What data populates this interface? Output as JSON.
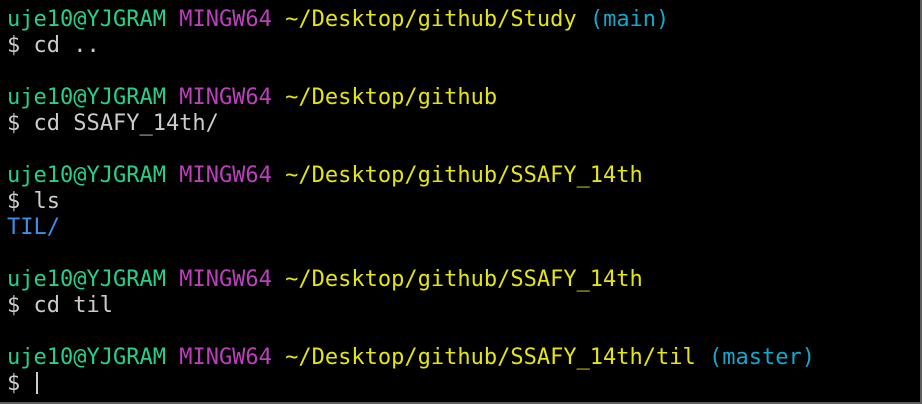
{
  "colors": {
    "background": "#000000",
    "user": "#23d18b",
    "system": "#bc3fbc",
    "path": "#e5e510",
    "branch": "#11a8cd",
    "directory": "#3b8eea",
    "text": "#cccccc"
  },
  "blocks": [
    {
      "prompt": {
        "user": "uje10@YJGRAM",
        "system": "MINGW64",
        "path": "~/Desktop/github/Study",
        "branch": "(main)"
      },
      "command": "$ cd .."
    },
    {
      "prompt": {
        "user": "uje10@YJGRAM",
        "system": "MINGW64",
        "path": "~/Desktop/github",
        "branch": ""
      },
      "command": "$ cd SSAFY_14th/"
    },
    {
      "prompt": {
        "user": "uje10@YJGRAM",
        "system": "MINGW64",
        "path": "~/Desktop/github/SSAFY_14th",
        "branch": ""
      },
      "command": "$ ls",
      "output": "TIL/"
    },
    {
      "prompt": {
        "user": "uje10@YJGRAM",
        "system": "MINGW64",
        "path": "~/Desktop/github/SSAFY_14th",
        "branch": ""
      },
      "command": "$ cd til"
    },
    {
      "prompt": {
        "user": "uje10@YJGRAM",
        "system": "MINGW64",
        "path": "~/Desktop/github/SSAFY_14th/til",
        "branch": "(master)"
      },
      "command": "$ "
    }
  ]
}
